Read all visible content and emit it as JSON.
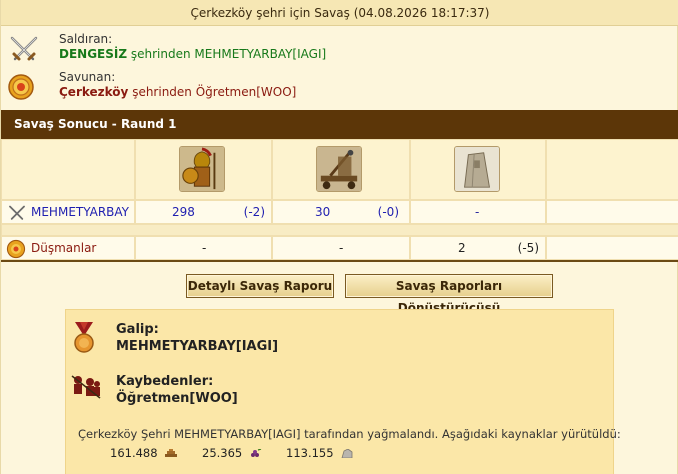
{
  "title": "Çerkezköy şehri için Savaş (04.08.2026 18:17:37)",
  "attacker": {
    "role_label": "Saldıran:",
    "city": "DENGESİZ",
    "from_text": " şehrinden ",
    "player": "MEHMETYARBAY[IAGI]",
    "icon": "crossed-swords-icon"
  },
  "defender": {
    "role_label": "Savunan:",
    "city": "Çerkezköy",
    "from_text": " şehrinden ",
    "player": "Öğretmen[WOO]",
    "icon": "shield-target-icon"
  },
  "result_header": "Savaş Sonucu - Raund 1",
  "units": [
    {
      "name": "hoplite-unit-icon"
    },
    {
      "name": "catapult-unit-icon"
    },
    {
      "name": "stone-wall-unit-icon"
    }
  ],
  "rows": [
    {
      "label": "MEHMETYARBAY",
      "cells": [
        {
          "count": "298",
          "loss": "(-2)"
        },
        {
          "count": "30",
          "loss": "(-0)"
        },
        {
          "count": "-",
          "loss": ""
        }
      ]
    },
    {
      "label": "Düşmanlar",
      "cells": [
        {
          "count": "-",
          "loss": ""
        },
        {
          "count": "-",
          "loss": ""
        },
        {
          "count": "2",
          "loss": "(-5)"
        }
      ]
    }
  ],
  "buttons": {
    "detailed_report": "Detaylı Savaş Raporu",
    "report_converter": "Savaş Raporları Dönüştürücüsü"
  },
  "summary": {
    "winner_label": "Galip:",
    "winner": "MEHMETYARBAY[IAGI]",
    "losers_label": "Kaybedenler:",
    "losers": "Öğretmen[WOO]",
    "plunder_text": "Çerkezköy Şehri MEHMETYARBAY[IAGI] tarafından yağmalandı. Aşağıdaki kaynaklar yürütüldü:",
    "resources": [
      {
        "amount": "161.488",
        "icon": "wood-icon"
      },
      {
        "amount": "25.365",
        "icon": "wine-icon"
      },
      {
        "amount": "113.155",
        "icon": "marble-icon"
      }
    ]
  },
  "colors": {
    "header_bg": "#5c3608",
    "attacker_text": "#17791a",
    "defender_text": "#8a1a10",
    "unit_count": "#1f1fb0"
  }
}
